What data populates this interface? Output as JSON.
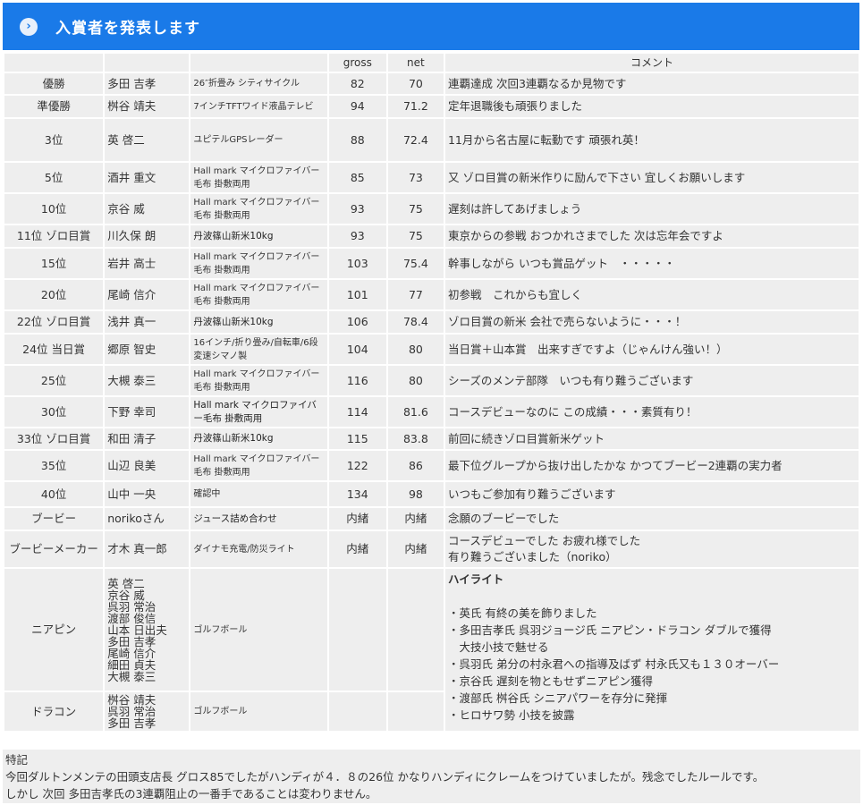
{
  "header": {
    "title": "入賞者を発表します",
    "icon": "chevron-right-icon",
    "bg_color": "#1a7ae8"
  },
  "columns": [
    "",
    "",
    "",
    "gross",
    "net",
    "コメント"
  ],
  "rows": [
    {
      "rank": "優勝",
      "name": "多田 吉孝",
      "prize": "26″折畳み シティサイクル",
      "gross": "82",
      "net": "70",
      "comment": "連覇達成 次回3連覇なるか見物です"
    },
    {
      "rank": "準優勝",
      "name": "桝谷 靖夫",
      "prize": "7インチTFTワイド液晶テレビ",
      "gross": "94",
      "net": "71.2",
      "comment": "定年退職後も頑張りました"
    },
    {
      "rank": "3位",
      "name": "英 啓二",
      "prize": "ユピテルGPSレーダー",
      "gross": "88",
      "net": "72.4",
      "comment": "11月から名古屋に転勤です 頑張れ英！"
    },
    {
      "rank": "5位",
      "name": "酒井 重文",
      "prize": "Hall mark マイクロファイバー毛布 掛敷両用",
      "gross": "85",
      "net": "73",
      "comment": "又 ゾロ目賞の新米作りに励んで下さい 宜しくお願いします"
    },
    {
      "rank": "10位",
      "name": "京谷 威",
      "prize": "Hall mark マイクロファイバー毛布 掛敷両用",
      "gross": "93",
      "net": "75",
      "comment": "遅刻は許してあげましょう"
    },
    {
      "rank": "11位 ゾロ目賞",
      "name": "川久保 朗",
      "prize": "丹波篠山新米10kg",
      "gross": "93",
      "net": "75",
      "comment": "東京からの参戦 おつかれさまでした 次は忘年会ですよ"
    },
    {
      "rank": "15位",
      "name": "岩井 高士",
      "prize": "Hall mark マイクロファイバー毛布 掛敷両用",
      "gross": "103",
      "net": "75.4",
      "comment": "幹事しながら いつも賞品ゲット　・・・・・"
    },
    {
      "rank": "20位",
      "name": "尾崎 信介",
      "prize": "Hall mark マイクロファイバー毛布 掛敷両用",
      "gross": "101",
      "net": "77",
      "comment": "初参戦　これからも宜しく"
    },
    {
      "rank": "22位 ゾロ目賞",
      "name": "浅井 真一",
      "prize": "丹波篠山新米10kg",
      "gross": "106",
      "net": "78.4",
      "comment": "ゾロ目賞の新米 会社で売らないように・・・！"
    },
    {
      "rank": "24位 当日賞",
      "name": "郷原 智史",
      "prize": "16インチ/折り畳み/自転車/6段変速シマノ製",
      "gross": "104",
      "net": "80",
      "comment": "当日賞＋山本賞　出来すぎですよ（じゃんけん強い！）"
    },
    {
      "rank": "25位",
      "name": "大槻 泰三",
      "prize": "Hall mark マイクロファイバー毛布 掛敷両用",
      "gross": "116",
      "net": "80",
      "comment": "シーズのメンテ部隊　いつも有り難うございます"
    },
    {
      "rank": "30位",
      "name": "下野 幸司",
      "prize": "Hall mark マイクロファイバー毛布 掛敷両用",
      "gross": "114",
      "net": "81.6",
      "comment": "コースデビューなのに この成績・・・素質有り！"
    },
    {
      "rank": "33位 ゾロ目賞",
      "name": "和田 清子",
      "prize": "丹波篠山新米10kg",
      "gross": "115",
      "net": "83.8",
      "comment": "前回に続きゾロ目賞新米ゲット"
    },
    {
      "rank": "35位",
      "name": "山辺 良美",
      "prize": "Hall mark マイクロファイバー毛布 掛敷両用",
      "gross": "122",
      "net": "86",
      "comment": "最下位グループから抜け出したかな かつてブービー2連覇の実力者"
    },
    {
      "rank": "40位",
      "name": "山中 一央",
      "prize": "確認中",
      "gross": "134",
      "net": "98",
      "comment": "いつもご参加有り難うございます"
    },
    {
      "rank": "ブービー",
      "name": "norikoさん",
      "prize": "ジュース詰め合わせ",
      "gross": "内緒",
      "net": "内緒",
      "comment": "念願のブービーでした"
    },
    {
      "rank": "ブービーメーカー",
      "name": "才木 真一郎",
      "prize": "ダイナモ充電/防災ライト",
      "gross": "内緒",
      "net": "内緒",
      "comment_lines": [
        "コースデビューでした お疲れ様でした",
        "有り難うございました（noriko）"
      ]
    }
  ],
  "nearpin": {
    "label": "ニアピン",
    "names": [
      "英 啓二",
      "京谷 威",
      "呉羽 常治",
      "渡部 俊信",
      "山本 日出夫",
      "多田 吉孝",
      "尾崎 信介",
      "細田 貞夫",
      "大槻 泰三"
    ],
    "prize": "ゴルフボール"
  },
  "dracon": {
    "label": "ドラコン",
    "names": [
      "桝谷 靖夫",
      "呉羽 常治",
      "多田 吉孝"
    ],
    "prize": "ゴルフボール"
  },
  "highlight": {
    "title": "ハイライト",
    "lines": [
      "・英氏 有終の美を飾りました",
      "・多田吉孝氏 呉羽ジョージ氏 ニアピン・ドラコン ダブルで獲得",
      "　大技小技で魅せる",
      "・呉羽氏 弟分の村永君への指導及ばず 村永氏又も１３０オーバー",
      "・京谷氏 遅刻を物ともせずニアピン獲得",
      "・渡部氏 桝谷氏 シニアパワーを存分に発揮",
      "・ヒロサワ勢 小技を披露"
    ]
  },
  "notes": {
    "title": "特記",
    "line1": "今回ダルトンメンテの田頭支店長 グロス85でしたがハンディが４．８の26位 かなりハンディにクレームをつけていましたが。残念でしたルールです。",
    "line2": "しかし 次回 多田吉孝氏の3連覇阻止の一番手であることは変わりません。"
  }
}
